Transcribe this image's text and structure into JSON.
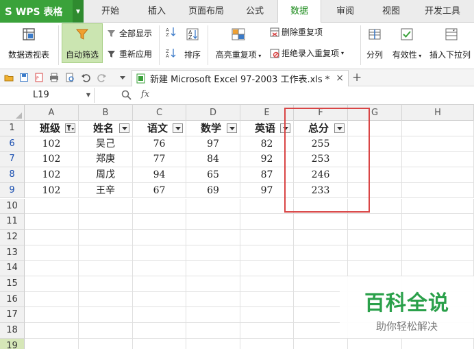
{
  "app": {
    "logo": "S",
    "name": "WPS 表格"
  },
  "tabs": [
    "开始",
    "插入",
    "页面布局",
    "公式",
    "数据",
    "审阅",
    "视图",
    "开发工具"
  ],
  "active_tab": "数据",
  "ribbon": {
    "pivot": "数据透视表",
    "autofilter": "自动筛选",
    "show_all": "全部显示",
    "reapply": "重新应用",
    "sort": "排序",
    "highlight_dup": "高亮重复项",
    "remove_dup": "删除重复项",
    "reject_dup": "拒绝录入重复项",
    "split": "分列",
    "validity": "有效性",
    "insert_dropdown": "插入下拉列"
  },
  "doc_tab": {
    "title": "新建 Microsoft Excel 97-2003 工作表.xls *",
    "close": "×",
    "add": "+"
  },
  "formula_bar": {
    "cell_ref": "L19",
    "fx": "fx"
  },
  "columns": [
    "A",
    "B",
    "C",
    "D",
    "E",
    "F",
    "G",
    "H"
  ],
  "header_row": {
    "row_num": "1",
    "cells": [
      "班级",
      "姓名",
      "语文",
      "数学",
      "英语",
      "总分"
    ]
  },
  "data_rows": [
    {
      "row_num": "6",
      "cells": [
        "102",
        "吴己",
        "76",
        "97",
        "82",
        "255"
      ]
    },
    {
      "row_num": "7",
      "cells": [
        "102",
        "郑庚",
        "77",
        "84",
        "92",
        "253"
      ]
    },
    {
      "row_num": "8",
      "cells": [
        "102",
        "周戊",
        "94",
        "65",
        "87",
        "246"
      ]
    },
    {
      "row_num": "9",
      "cells": [
        "102",
        "王辛",
        "67",
        "69",
        "97",
        "233"
      ]
    }
  ],
  "empty_rows": [
    "10",
    "11",
    "12",
    "13",
    "14",
    "15",
    "16",
    "17",
    "18",
    "19"
  ],
  "watermark": {
    "big": "百科全说",
    "small": "助你轻松解决"
  },
  "colors": {
    "brand": "#3aa23a",
    "accent_tab": "#1a8a1a",
    "highlight_box": "#d94545",
    "filtered_row_num": "#1a4fb0"
  }
}
